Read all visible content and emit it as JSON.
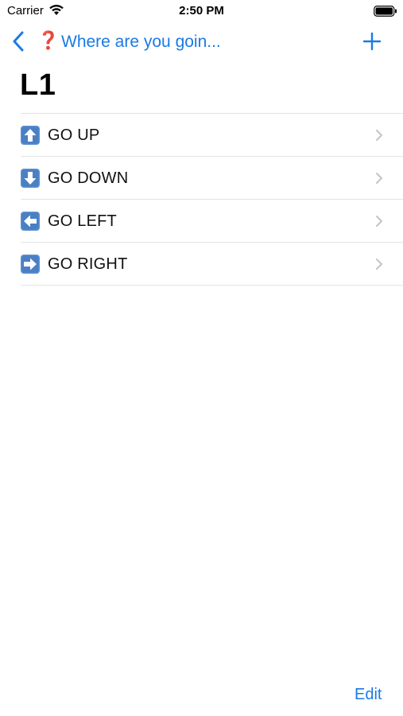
{
  "status_bar": {
    "carrier": "Carrier",
    "time": "2:50 PM"
  },
  "nav": {
    "back_glyph": "❓",
    "back_label": "Where are you goin...",
    "accent_color": "#1a7ae6"
  },
  "title": "L1",
  "rows": [
    {
      "icon": "up-arrow-icon",
      "label": "GO UP"
    },
    {
      "icon": "down-arrow-icon",
      "label": "GO DOWN"
    },
    {
      "icon": "left-arrow-icon",
      "label": "GO LEFT"
    },
    {
      "icon": "right-arrow-icon",
      "label": "GO RIGHT"
    }
  ],
  "toolbar": {
    "edit_label": "Edit"
  }
}
